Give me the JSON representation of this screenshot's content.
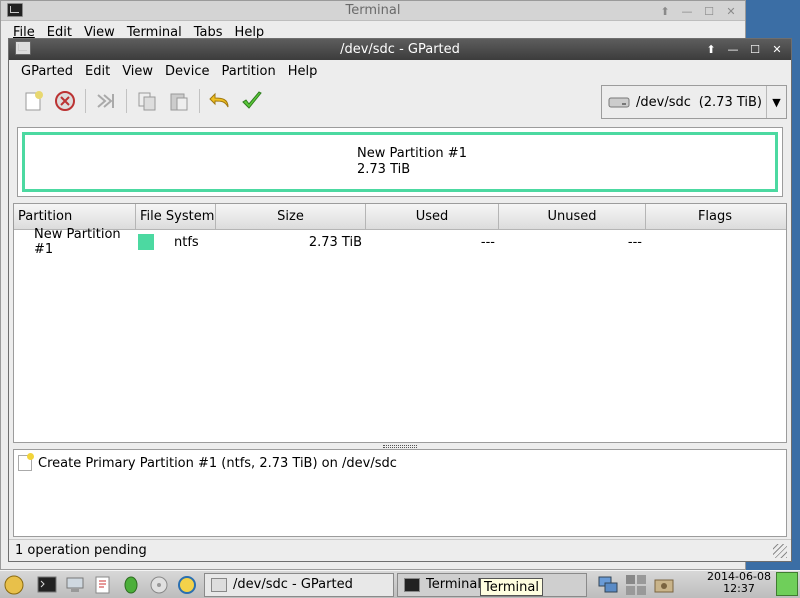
{
  "terminal_window": {
    "title": "Terminal",
    "menu": [
      "File",
      "Edit",
      "View",
      "Terminal",
      "Tabs",
      "Help"
    ]
  },
  "gparted": {
    "title": "/dev/sdc - GParted",
    "menu": [
      "GParted",
      "Edit",
      "View",
      "Device",
      "Partition",
      "Help"
    ],
    "device_selector": {
      "device": "/dev/sdc",
      "size": "(2.73 TiB)"
    },
    "partition_map": {
      "name": "New Partition #1",
      "size": "2.73 TiB",
      "color": "#4cd9a1"
    },
    "table": {
      "headers": [
        "Partition",
        "File System",
        "Size",
        "Used",
        "Unused",
        "Flags"
      ],
      "rows": [
        {
          "partition": "New Partition #1",
          "fs": "ntfs",
          "size": "2.73 TiB",
          "used": "---",
          "unused": "---",
          "flags": ""
        }
      ]
    },
    "operations": [
      "Create Primary Partition #1 (ntfs, 2.73 TiB) on /dev/sdc"
    ],
    "status": "1 operation pending"
  },
  "taskbar": {
    "tasks": [
      "/dev/sdc - GParted",
      "Terminal"
    ],
    "tooltip": "Terminal",
    "date": "2014-06-08",
    "time": "12:37"
  }
}
